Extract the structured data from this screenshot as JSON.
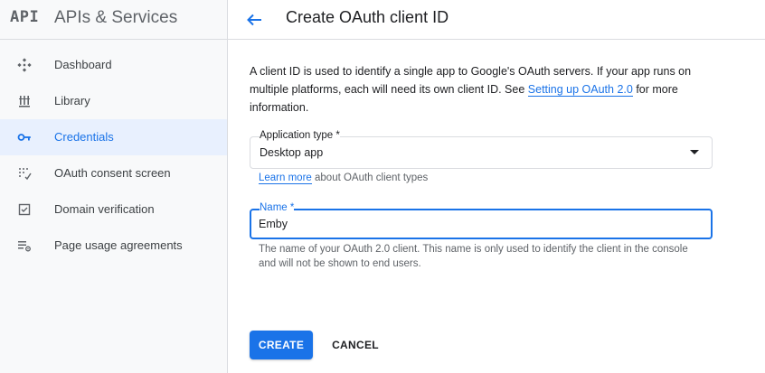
{
  "brand": {
    "logo": "API",
    "title": "APIs & Services"
  },
  "sidebar": {
    "items": [
      {
        "label": "Dashboard",
        "icon": "dashboard-icon",
        "active": false
      },
      {
        "label": "Library",
        "icon": "library-icon",
        "active": false
      },
      {
        "label": "Credentials",
        "icon": "key-icon",
        "active": true
      },
      {
        "label": "OAuth consent screen",
        "icon": "consent-icon",
        "active": false
      },
      {
        "label": "Domain verification",
        "icon": "checkbox-icon",
        "active": false
      },
      {
        "label": "Page usage agreements",
        "icon": "settings-list-icon",
        "active": false
      }
    ]
  },
  "header": {
    "back_icon": "arrow-back-icon",
    "title": "Create OAuth client ID"
  },
  "intro": {
    "text_before": "A client ID is used to identify a single app to Google's OAuth servers. If your app runs on multiple platforms, each will need its own client ID. See ",
    "link_text": "Setting up OAuth 2.0",
    "text_after": " for more information."
  },
  "application_type": {
    "label": "Application type *",
    "value": "Desktop app"
  },
  "learn_more": {
    "link_text": "Learn more",
    "text": " about OAuth client types"
  },
  "name_field": {
    "label": "Name *",
    "value": "Emby",
    "hint": "The name of your OAuth 2.0 client. This name is only used to identify the client in the console and will not be shown to end users."
  },
  "actions": {
    "create_label": "CREATE",
    "cancel_label": "CANCEL"
  },
  "colors": {
    "accent": "#1a73e8",
    "active_bg": "#e8f0fe",
    "sidebar_bg": "#f8f9fa"
  }
}
